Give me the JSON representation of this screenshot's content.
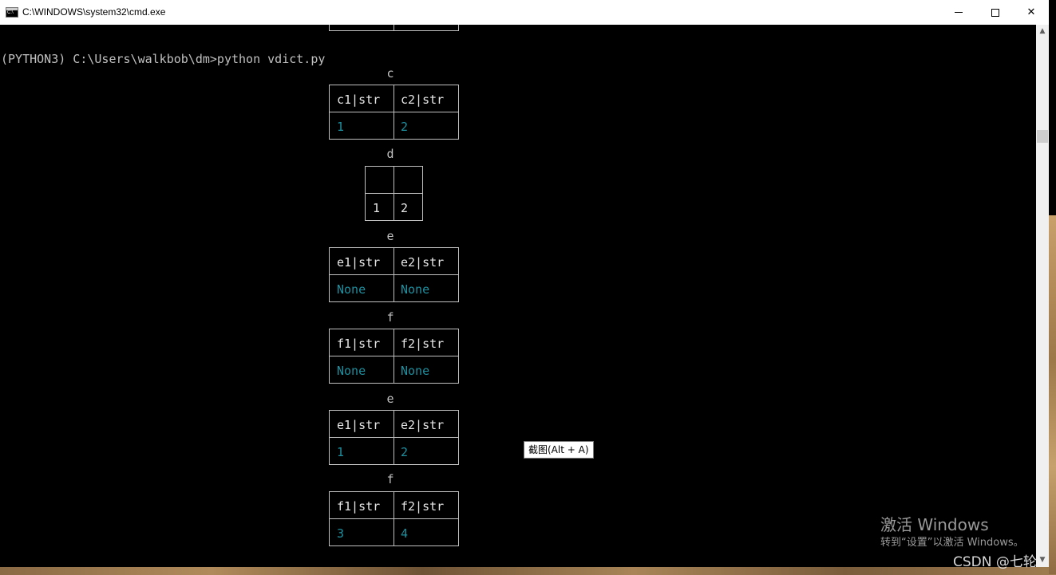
{
  "window": {
    "title": "C:\\WINDOWS\\system32\\cmd.exe",
    "minimize": "minimize",
    "maximize": "maximize",
    "close": "✕"
  },
  "console": {
    "prompt": "(PYTHON3) C:\\Users\\walkbob\\dm>python vdict.py",
    "tables": [
      {
        "title": "c",
        "headers": [
          "c1|str",
          "c2|str"
        ],
        "values": [
          "1",
          "2"
        ]
      },
      {
        "title": "d",
        "headers": [
          "",
          ""
        ],
        "values": [
          "1",
          "2"
        ]
      },
      {
        "title": "e",
        "headers": [
          "e1|str",
          "e2|str"
        ],
        "values": [
          "None",
          "None"
        ]
      },
      {
        "title": "f",
        "headers": [
          "f1|str",
          "f2|str"
        ],
        "values": [
          "None",
          "None"
        ]
      },
      {
        "title": "e",
        "headers": [
          "e1|str",
          "e2|str"
        ],
        "values": [
          "1",
          "2"
        ]
      },
      {
        "title": "f",
        "headers": [
          "f1|str",
          "f2|str"
        ],
        "values": [
          "3",
          "4"
        ]
      }
    ]
  },
  "tooltip": {
    "text": "截图(Alt + A)"
  },
  "watermark": {
    "title": "激活 Windows",
    "subtitle": "转到“设置”以激活 Windows。"
  },
  "csdn": {
    "text": "CSDN @七轮"
  },
  "colors": {
    "console_bg": "#000000",
    "console_text": "#c0c0c0",
    "value_text": "#1d8f9e"
  }
}
